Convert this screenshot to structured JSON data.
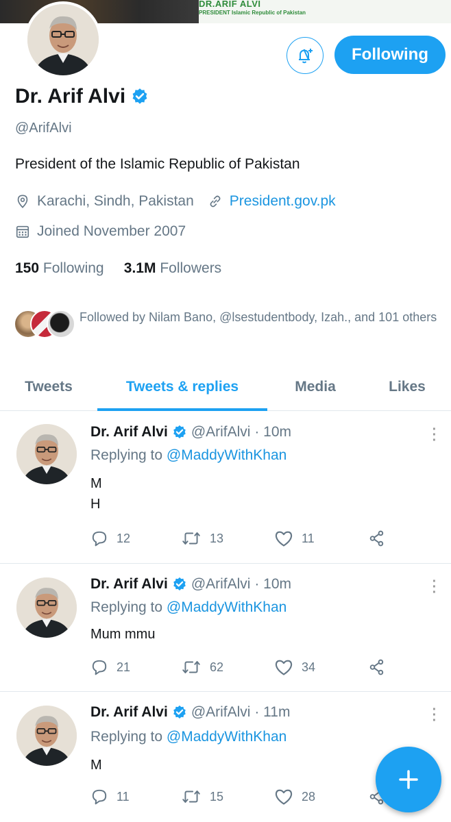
{
  "banner": {
    "title": "DR.ARIF ALVI",
    "subtitle": "PRESIDENT Islamic Republic of Pakistan"
  },
  "profile": {
    "name": "Dr. Arif Alvi",
    "handle": "@ArifAlvi",
    "bio": "President of the Islamic Republic of Pakistan",
    "location": "Karachi, Sindh, Pakistan",
    "website": "President.gov.pk",
    "joined": "Joined November 2007",
    "following_count": "150",
    "following_label": "Following",
    "followers_count": "3.1M",
    "followers_label": "Followers",
    "followed_by": "Followed by Nilam Bano, @lsestudentbody, Izah., and 101 others",
    "follow_button": "Following",
    "verified_color": "#1da1f2"
  },
  "tabs": [
    {
      "label": "Tweets"
    },
    {
      "label": "Tweets & replies"
    },
    {
      "label": "Media"
    },
    {
      "label": "Likes"
    }
  ],
  "tweets": [
    {
      "name": "Dr. Arif Alvi",
      "handle": "@ArifAlvi",
      "time": "· 10m",
      "replying_prefix": "Replying to",
      "replying_handle": "@MaddyWithKhan",
      "body_lines": [
        "M",
        "H"
      ],
      "replies": "12",
      "retweets": "13",
      "likes": "11"
    },
    {
      "name": "Dr. Arif Alvi",
      "handle": "@ArifAlvi",
      "time": "· 10m",
      "replying_prefix": "Replying to",
      "replying_handle": "@MaddyWithKhan",
      "body_lines": [
        "Mum mmu"
      ],
      "replies": "21",
      "retweets": "62",
      "likes": "34"
    },
    {
      "name": "Dr. Arif Alvi",
      "handle": "@ArifAlvi",
      "time": "· 11m",
      "replying_prefix": "Replying to",
      "replying_handle": "@MaddyWithKhan",
      "body_lines": [
        "M"
      ],
      "replies": "11",
      "retweets": "15",
      "likes": "28"
    }
  ],
  "colors": {
    "accent": "#1da1f2",
    "link": "#1b95e0",
    "secondary_text": "#657786"
  },
  "icons": [
    "bell-plus-icon",
    "verified-badge-icon",
    "location-pin-icon",
    "link-icon",
    "calendar-icon",
    "reply-icon",
    "retweet-icon",
    "like-icon",
    "share-icon",
    "more-vertical-icon",
    "compose-plus-icon"
  ]
}
